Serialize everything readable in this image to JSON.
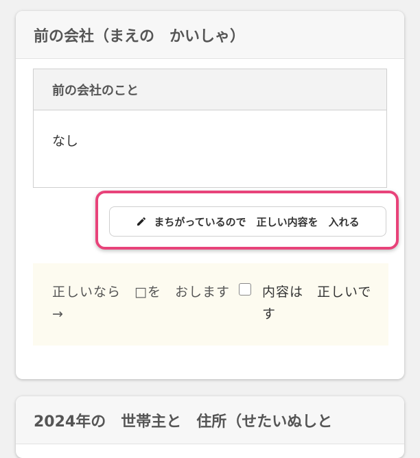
{
  "section1": {
    "title": "前の会社（まえの　かいしゃ）",
    "table": {
      "header": "前の会社のこと",
      "value": "なし"
    },
    "edit_button": {
      "icon": "pencil-icon",
      "label": "まちがっているので　正しい内容を　入れる"
    },
    "confirm": {
      "instruction": "正しいなら　□を　おします　→",
      "checkbox_label": "内容は　正しいです",
      "checked": false
    }
  },
  "section2": {
    "title": "2024年の　世帯主と　住所（せたいぬしと"
  },
  "colors": {
    "highlight": "#e8437a",
    "confirm_background": "#fdfbf0"
  }
}
